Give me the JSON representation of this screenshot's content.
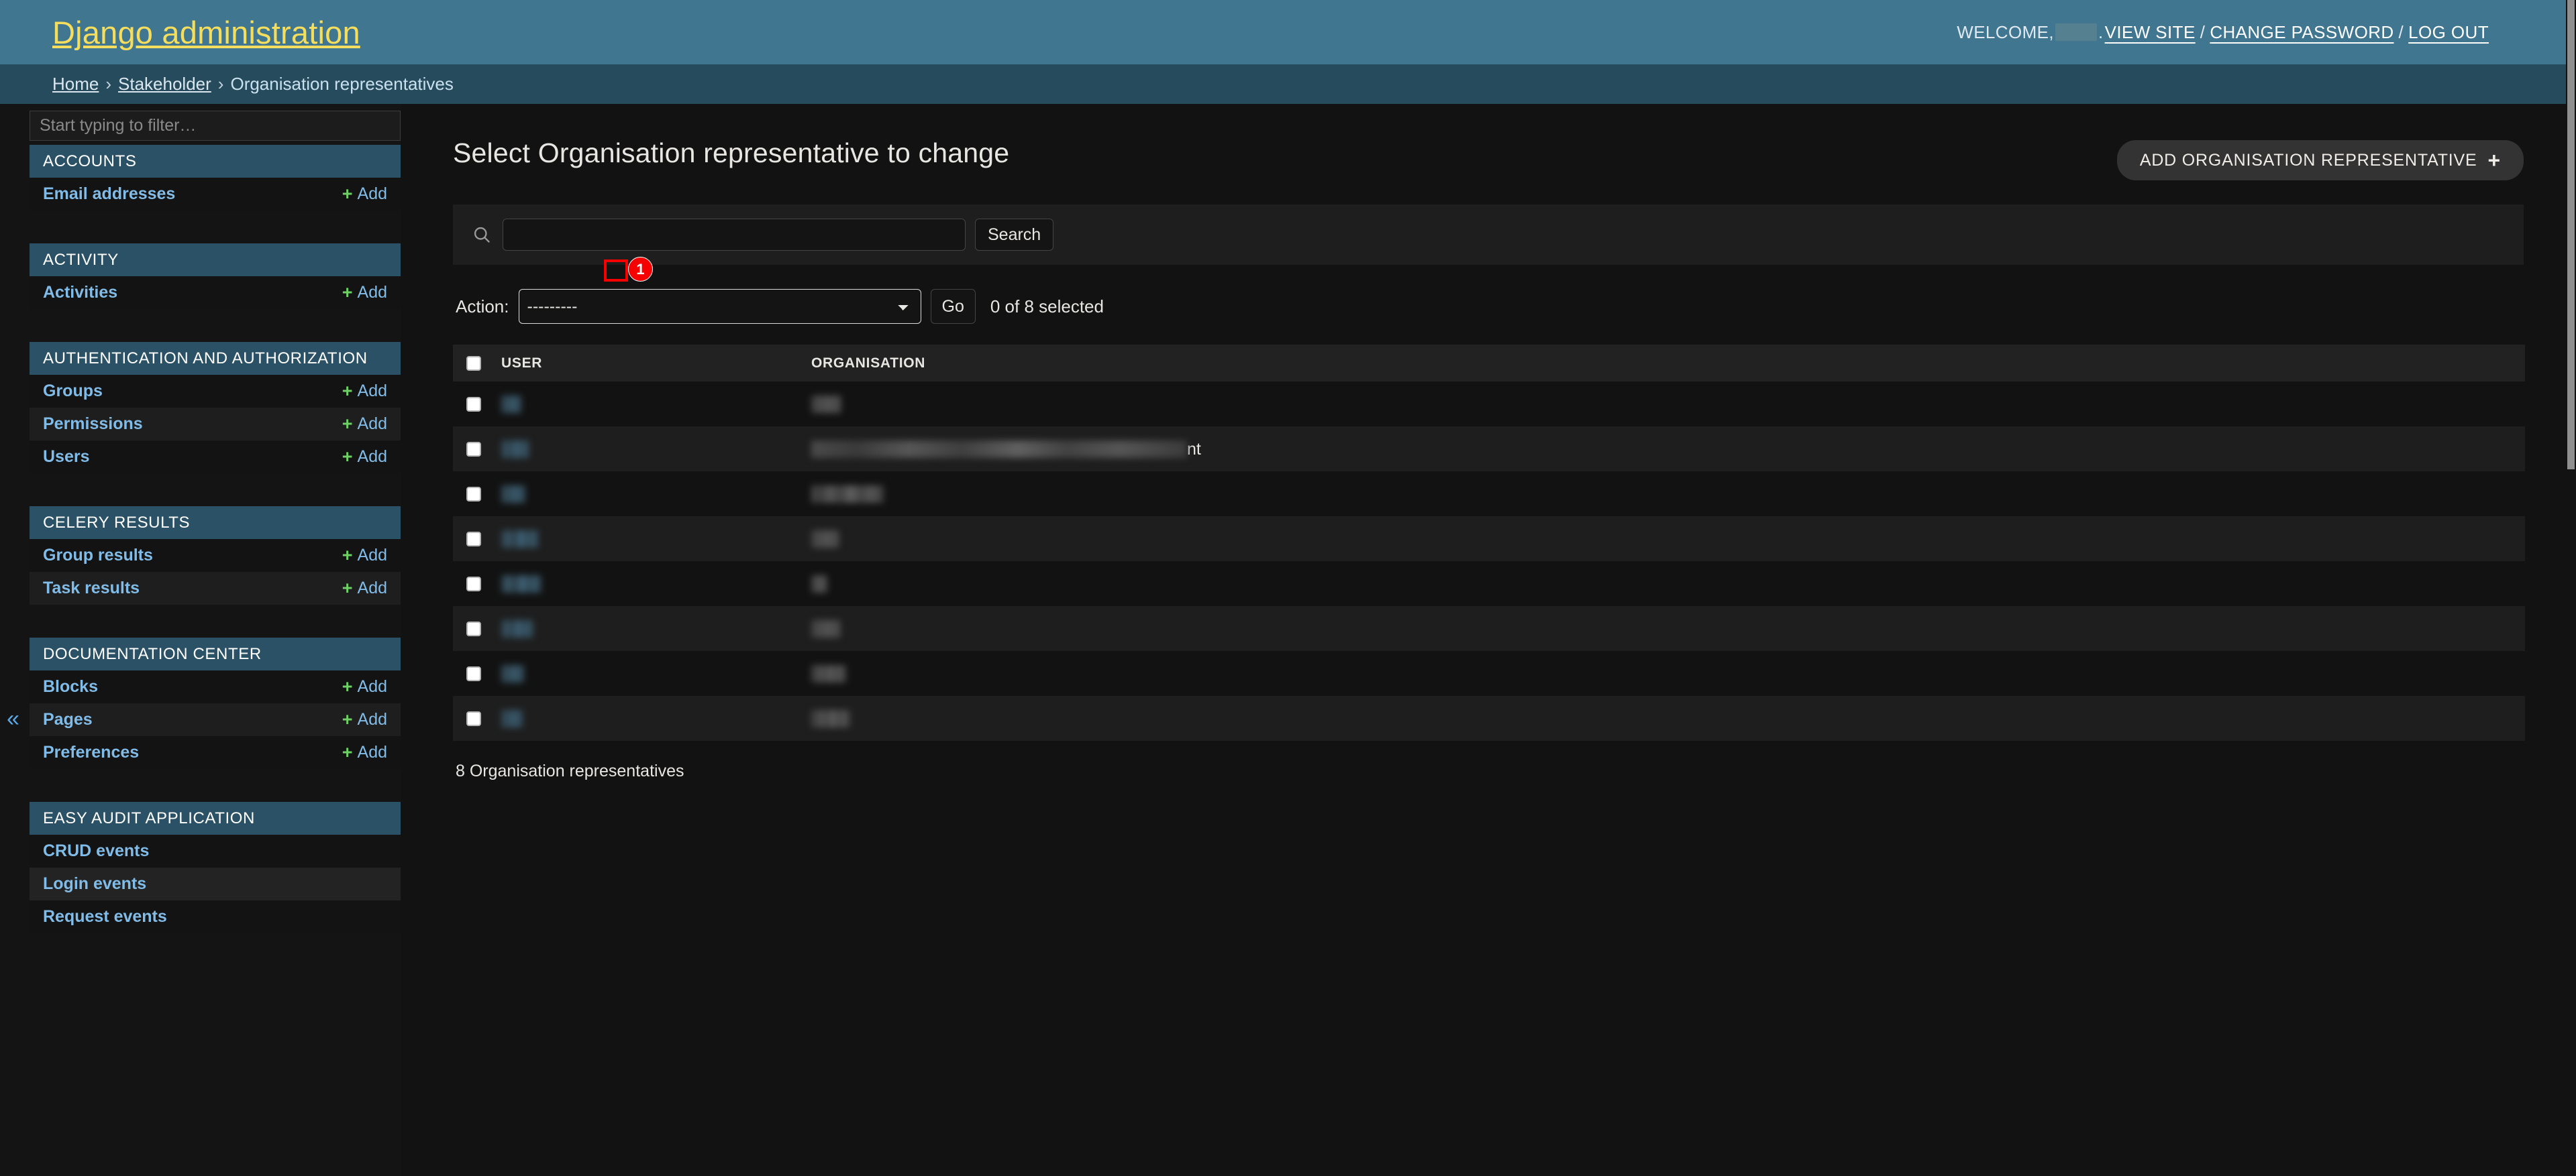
{
  "branding": {
    "site_title": "Django administration",
    "welcome_label": "WELCOME,",
    "username_redacted": "",
    "period": ".",
    "view_site": "VIEW SITE",
    "change_password": "CHANGE PASSWORD",
    "log_out": "LOG OUT",
    "separator": "/",
    "header_bg": "#417690",
    "title_color": "#f5dd5d"
  },
  "breadcrumbs": {
    "home": "Home",
    "app": "Stakeholder",
    "current": "Organisation representatives",
    "separator": "›",
    "bg": "#264b5d"
  },
  "sidebar": {
    "filter_placeholder": "Start typing to filter…",
    "filter_value": "",
    "collapse_icon": "«",
    "add_label": "Add",
    "header_bg": "#2b5166",
    "link_color": "#81bce8",
    "plus_color": "#6cd063",
    "apps": [
      {
        "name": "ACCOUNTS",
        "models": [
          {
            "label": "Email addresses",
            "has_add": true,
            "selected": false
          }
        ]
      },
      {
        "name": "ACTIVITY",
        "models": [
          {
            "label": "Activities",
            "has_add": true,
            "selected": false
          }
        ]
      },
      {
        "name": "AUTHENTICATION AND AUTHORIZATION",
        "models": [
          {
            "label": "Groups",
            "has_add": true,
            "selected": false
          },
          {
            "label": "Permissions",
            "has_add": true,
            "selected": false
          },
          {
            "label": "Users",
            "has_add": true,
            "selected": false
          }
        ]
      },
      {
        "name": "CELERY RESULTS",
        "models": [
          {
            "label": "Group results",
            "has_add": true,
            "selected": false
          },
          {
            "label": "Task results",
            "has_add": true,
            "selected": false
          }
        ]
      },
      {
        "name": "DOCUMENTATION CENTER",
        "models": [
          {
            "label": "Blocks",
            "has_add": true,
            "selected": false
          },
          {
            "label": "Pages",
            "has_add": true,
            "selected": false
          },
          {
            "label": "Preferences",
            "has_add": true,
            "selected": false
          }
        ]
      },
      {
        "name": "EASY AUDIT APPLICATION",
        "models": [
          {
            "label": "CRUD events",
            "has_add": false,
            "selected": false
          },
          {
            "label": "Login events",
            "has_add": false,
            "selected": true
          },
          {
            "label": "Request events",
            "has_add": false,
            "selected": false
          }
        ]
      }
    ]
  },
  "main": {
    "page_title": "Select Organisation representative to change",
    "add_button_label": "ADD ORGANISATION REPRESENTATIVE",
    "add_button_icon": "plus-icon",
    "search": {
      "icon": "search-icon",
      "value": "",
      "placeholder": "",
      "submit_label": "Search"
    },
    "actions": {
      "label": "Action:",
      "selected_option": "---------",
      "options": [
        "---------"
      ],
      "go_label": "Go",
      "counter": "0 of 8 selected"
    },
    "table": {
      "columns": [
        "USER",
        "ORGANISATION"
      ],
      "select_all_checkbox": false,
      "rows": [
        {
          "checked": false,
          "user": "",
          "user_redacted": true,
          "user_width": 30,
          "org": "",
          "org_redacted": true,
          "org_width": 45,
          "org_tail": ""
        },
        {
          "checked": false,
          "user": "",
          "user_redacted": true,
          "user_width": 42,
          "org": "",
          "org_redacted": true,
          "org_width": 560,
          "org_tail": "nt"
        },
        {
          "checked": false,
          "user": "",
          "user_redacted": true,
          "user_width": 36,
          "org": "",
          "org_redacted": true,
          "org_width": 108,
          "org_tail": ""
        },
        {
          "checked": false,
          "user": "",
          "user_redacted": true,
          "user_width": 56,
          "org": "",
          "org_redacted": true,
          "org_width": 42,
          "org_tail": ""
        },
        {
          "checked": false,
          "user": "",
          "user_redacted": true,
          "user_width": 60,
          "org": "",
          "org_redacted": true,
          "org_width": 24,
          "org_tail": ""
        },
        {
          "checked": false,
          "user": "",
          "user_redacted": true,
          "user_width": 48,
          "org": "",
          "org_redacted": true,
          "org_width": 44,
          "org_tail": ""
        },
        {
          "checked": false,
          "user": "",
          "user_redacted": true,
          "user_width": 34,
          "org": "",
          "org_redacted": true,
          "org_width": 52,
          "org_tail": ""
        },
        {
          "checked": false,
          "user": "",
          "user_redacted": true,
          "user_width": 32,
          "org": "",
          "org_redacted": true,
          "org_width": 58,
          "org_tail": ""
        }
      ]
    },
    "result_count": "8 Organisation representatives"
  },
  "annotations": [
    {
      "id": "1",
      "label": "1",
      "target": "first-row-user-cell",
      "color": "#f60000"
    }
  ],
  "scrollbar": {
    "thumb_color": "#8f8f8f",
    "orientation": "vertical"
  }
}
